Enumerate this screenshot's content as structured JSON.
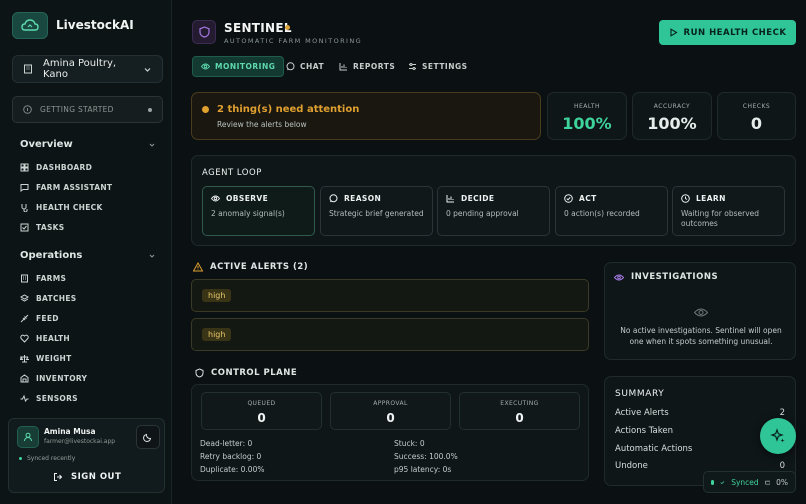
{
  "app": {
    "name": "LivestockAI"
  },
  "sidebar": {
    "farm": "Amina Poultry, Kano",
    "getting_started": "GETTING STARTED",
    "overview": {
      "title": "Overview",
      "items": [
        {
          "label": "DASHBOARD",
          "icon": "grid-icon"
        },
        {
          "label": "FARM ASSISTANT",
          "icon": "chat-icon"
        },
        {
          "label": "HEALTH CHECK",
          "icon": "stethoscope-icon"
        },
        {
          "label": "TASKS",
          "icon": "checkbox-icon"
        }
      ]
    },
    "operations": {
      "title": "Operations",
      "items": [
        {
          "label": "FARMS",
          "icon": "building-icon"
        },
        {
          "label": "BATCHES",
          "icon": "layers-icon"
        },
        {
          "label": "FEED",
          "icon": "wheat-icon"
        },
        {
          "label": "HEALTH",
          "icon": "heart-pulse-icon"
        },
        {
          "label": "WEIGHT",
          "icon": "scale-icon"
        },
        {
          "label": "INVENTORY",
          "icon": "warehouse-icon"
        },
        {
          "label": "SENSORS",
          "icon": "activity-icon"
        }
      ]
    },
    "user": {
      "name": "Amina Musa",
      "email": "farmer@livestockai.app",
      "sync": "Synced recently",
      "signout": "SIGN OUT"
    }
  },
  "header": {
    "title": "SENTINEL",
    "subtitle": "AUTOMATIC FARM MONITORING",
    "run_button": "RUN HEALTH CHECK",
    "tabs": [
      {
        "label": "MONITORING",
        "icon": "eye-icon",
        "active": true
      },
      {
        "label": "CHAT",
        "icon": "chat-icon",
        "active": false
      },
      {
        "label": "REPORTS",
        "icon": "bar-chart-icon",
        "active": false
      },
      {
        "label": "SETTINGS",
        "icon": "sliders-icon",
        "active": false
      }
    ]
  },
  "attention": {
    "title": "2 thing(s) need attention",
    "subtitle": "Review the alerts below",
    "color": "#e0a030"
  },
  "stats": [
    {
      "label": "HEALTH",
      "value": "100%",
      "color": "#3fd39c"
    },
    {
      "label": "ACCURACY",
      "value": "100%",
      "color": "#f2f5f4"
    },
    {
      "label": "CHECKS",
      "value": "0",
      "color": "#f2f5f4"
    }
  ],
  "agent_loop": {
    "title": "AGENT LOOP",
    "steps": [
      {
        "label": "OBSERVE",
        "desc": "2 anomaly signal(s)",
        "icon": "eye-icon"
      },
      {
        "label": "REASON",
        "desc": "Strategic brief generated",
        "icon": "chat-icon"
      },
      {
        "label": "DECIDE",
        "desc": "0 pending approval",
        "icon": "bar-chart-icon"
      },
      {
        "label": "ACT",
        "desc": "0 action(s) recorded",
        "icon": "check-circle-icon"
      },
      {
        "label": "LEARN",
        "desc": "Waiting for observed outcomes",
        "icon": "clock-icon"
      }
    ]
  },
  "alerts": {
    "title": "ACTIVE ALERTS (2)",
    "items": [
      {
        "severity": "high"
      },
      {
        "severity": "high"
      }
    ]
  },
  "control_plane": {
    "title": "CONTROL PLANE",
    "queues": [
      {
        "label": "QUEUED",
        "value": "0"
      },
      {
        "label": "APPROVAL",
        "value": "0"
      },
      {
        "label": "EXECUTING",
        "value": "0"
      }
    ],
    "metrics_left": [
      "Dead-letter: 0",
      "Retry backlog: 0",
      "Duplicate: 0.00%"
    ],
    "metrics_right": [
      "Stuck: 0",
      "Success: 100.0%",
      "p95 latency: 0s"
    ]
  },
  "investigations": {
    "title": "INVESTIGATIONS",
    "empty": "No active investigations. Sentinel will open one when it spots something unusual."
  },
  "summary": {
    "title": "SUMMARY",
    "rows": [
      {
        "label": "Active Alerts",
        "value": "2"
      },
      {
        "label": "Actions Taken",
        "value": ""
      },
      {
        "label": "Automatic Actions",
        "value": ""
      },
      {
        "label": "Undone",
        "value": "0"
      }
    ]
  },
  "footer": {
    "synced": "Synced",
    "percent": "0%"
  }
}
